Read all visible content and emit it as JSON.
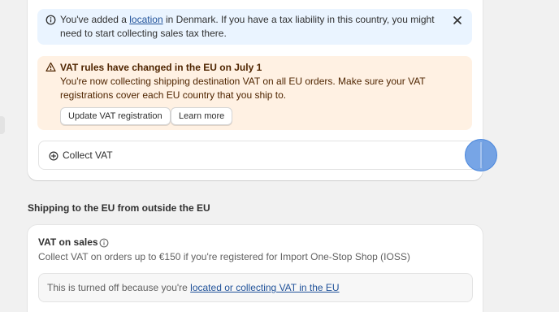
{
  "info_banner": {
    "text_before": "You've added a ",
    "link": "location",
    "text_after": " in Denmark. If you have a tax liability in this country, you might need to start collecting sales tax there."
  },
  "warning_banner": {
    "title": "VAT rules have changed in the EU on July 1",
    "text": "You're now collecting shipping destination VAT on all EU orders. Make sure your VAT registrations cover each EU country that you ship to.",
    "primary_button": "Update VAT registration",
    "secondary_button": "Learn more"
  },
  "collect_vat": {
    "label": "Collect VAT"
  },
  "section": {
    "title": "Shipping to the EU from outside the EU"
  },
  "vat_on_sales": {
    "title": "VAT on sales",
    "subtitle": "Collect VAT on orders up to €150 if you're registered for Import One-Stop Shop (IOSS)",
    "status_text": "This is turned off because you're ",
    "status_link": "located or collecting VAT in the EU"
  },
  "icons": {
    "info": "info-circle-icon",
    "close": "close-icon",
    "warning": "alert-triangle-icon",
    "add": "plus-circle-icon",
    "help": "info-circle-icon"
  },
  "colors": {
    "info_bg": "#eaf4ff",
    "warning_bg": "#fff1e3",
    "link": "#005bd3",
    "drag_handle": "#4a87dd"
  }
}
